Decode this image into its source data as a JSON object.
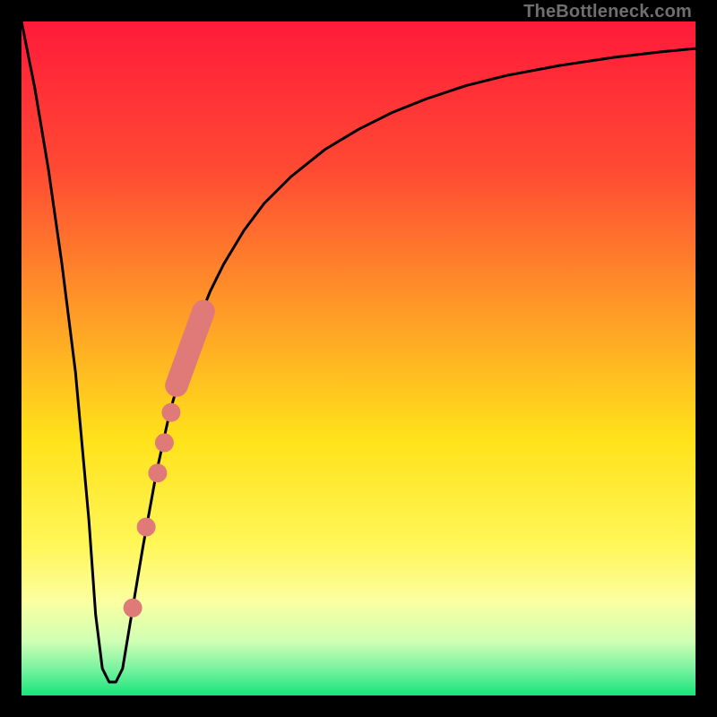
{
  "attribution": "TheBottleneck.com",
  "colors": {
    "background": "#000000",
    "gradient_stops": [
      {
        "pos": 0.0,
        "color": "#ff1a3a"
      },
      {
        "pos": 0.22,
        "color": "#ff4a33"
      },
      {
        "pos": 0.45,
        "color": "#ffa226"
      },
      {
        "pos": 0.62,
        "color": "#ffe21a"
      },
      {
        "pos": 0.78,
        "color": "#fff75a"
      },
      {
        "pos": 0.86,
        "color": "#fbffa0"
      },
      {
        "pos": 0.92,
        "color": "#cfffb4"
      },
      {
        "pos": 0.96,
        "color": "#7af3a0"
      },
      {
        "pos": 1.0,
        "color": "#17e47a"
      }
    ],
    "curve": "#000000",
    "markers": "#e07a78"
  },
  "chart_data": {
    "type": "line",
    "title": "",
    "xlabel": "",
    "ylabel": "",
    "xlim": [
      0,
      100
    ],
    "ylim": [
      0,
      100
    ],
    "grid": false,
    "legend": false,
    "series": [
      {
        "name": "bottleneck-curve",
        "x": [
          0,
          2,
          4,
          6,
          8,
          10,
          11,
          12,
          13,
          14,
          15,
          16,
          18,
          20,
          22,
          24,
          26,
          28,
          30,
          33,
          36,
          40,
          45,
          50,
          55,
          60,
          66,
          72,
          80,
          88,
          95,
          100
        ],
        "y": [
          100,
          90,
          78,
          64,
          48,
          26,
          12,
          4,
          2,
          2,
          4,
          10,
          22,
          33,
          42,
          49,
          55,
          60,
          64,
          69,
          73,
          77,
          81,
          84,
          86.5,
          88.5,
          90.5,
          92,
          93.5,
          94.7,
          95.5,
          96
        ]
      }
    ],
    "markers": [
      {
        "kind": "pill",
        "x0": 23.0,
        "y0": 46.0,
        "x1": 27.0,
        "y1": 57.0,
        "r": 1.7
      },
      {
        "kind": "point",
        "x": 22.2,
        "y": 42.0,
        "r": 1.4
      },
      {
        "kind": "point",
        "x": 21.2,
        "y": 37.5,
        "r": 1.4
      },
      {
        "kind": "point",
        "x": 20.2,
        "y": 33.0,
        "r": 1.4
      },
      {
        "kind": "point",
        "x": 18.5,
        "y": 25.0,
        "r": 1.4
      },
      {
        "kind": "point",
        "x": 16.5,
        "y": 13.0,
        "r": 1.4
      }
    ]
  }
}
